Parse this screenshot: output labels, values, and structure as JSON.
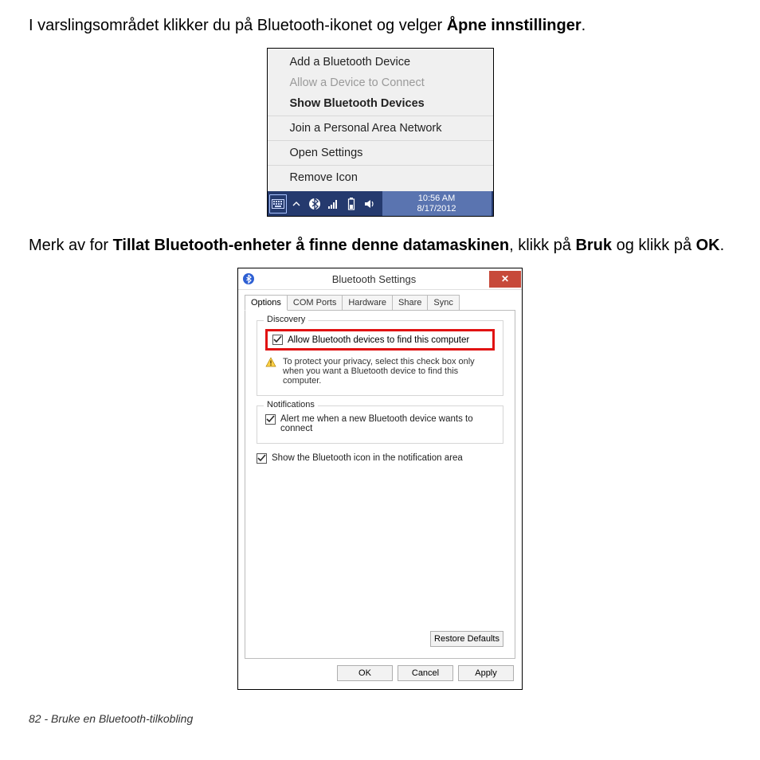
{
  "para1": {
    "prefix": "I varslingsområdet klikker du på Bluetooth-ikonet og velger ",
    "bold": "Åpne innstillinger",
    "suffix": "."
  },
  "contextMenu": {
    "items": [
      {
        "label": "Add a Bluetooth Device",
        "bold": false,
        "disabled": false
      },
      {
        "label": "Allow a Device to Connect",
        "bold": false,
        "disabled": true
      },
      {
        "label": "Show Bluetooth Devices",
        "bold": true,
        "disabled": false
      },
      {
        "label": "Join a Personal Area Network",
        "bold": false,
        "disabled": false
      },
      {
        "label": "Open Settings",
        "bold": false,
        "disabled": false
      },
      {
        "label": "Remove Icon",
        "bold": false,
        "disabled": false
      }
    ],
    "clock": {
      "time": "10:56 AM",
      "date": "8/17/2012"
    }
  },
  "para2": {
    "p1": "Merk av for ",
    "b1": "Tillat Bluetooth-enheter å finne denne datamaskinen",
    "p2": ", klikk på ",
    "b2": "Bruk",
    "p3": " og klikk på ",
    "b3": "OK",
    "p4": "."
  },
  "dialog": {
    "title": "Bluetooth Settings",
    "close": "✕",
    "tabs": [
      "Options",
      "COM Ports",
      "Hardware",
      "Share",
      "Sync"
    ],
    "discovery": {
      "legend": "Discovery",
      "checkboxLabel": "Allow Bluetooth devices to find this computer",
      "info": "To protect your privacy, select this check box only when you want a Bluetooth device to find this computer."
    },
    "notifications": {
      "legend": "Notifications",
      "checkboxLabel": "Alert me when a new Bluetooth device wants to connect"
    },
    "showIcon": "Show the Bluetooth icon in the notification area",
    "restore": "Restore Defaults",
    "ok": "OK",
    "cancel": "Cancel",
    "apply": "Apply"
  },
  "footer": "82 - Bruke en Bluetooth-tilkobling"
}
